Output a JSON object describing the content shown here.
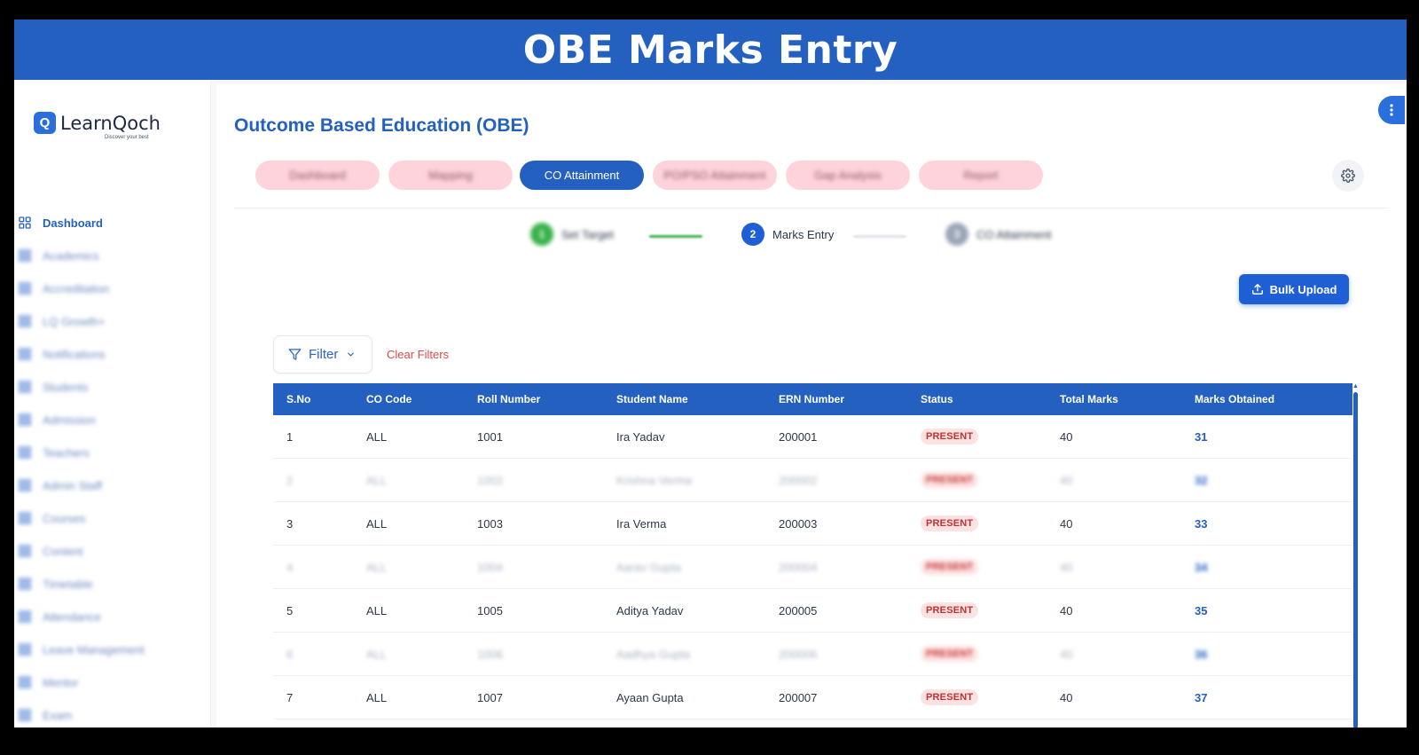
{
  "banner": {
    "title": "OBE Marks Entry"
  },
  "brand": {
    "name": "LearnQoch",
    "tagline": "Discover your best",
    "mark": "Q"
  },
  "sidebar": {
    "items": [
      {
        "label": "Dashboard",
        "icon": "dashboard-icon",
        "active": true
      },
      {
        "label": "Academics",
        "icon": "academics-icon"
      },
      {
        "label": "Accreditation",
        "icon": "accreditation-icon"
      },
      {
        "label": "LQ Growth+",
        "icon": "growth-icon"
      },
      {
        "label": "Notifications",
        "icon": "bell-icon"
      },
      {
        "label": "Students",
        "icon": "students-icon"
      },
      {
        "label": "Admission",
        "icon": "admission-icon"
      },
      {
        "label": "Teachers",
        "icon": "teachers-icon"
      },
      {
        "label": "Admin Staff",
        "icon": "staff-icon"
      },
      {
        "label": "Courses",
        "icon": "courses-icon"
      },
      {
        "label": "Content",
        "icon": "content-icon"
      },
      {
        "label": "Timetable",
        "icon": "timetable-icon"
      },
      {
        "label": "Attendance",
        "icon": "attendance-icon"
      },
      {
        "label": "Leave Management",
        "icon": "leave-icon"
      },
      {
        "label": "Mentor",
        "icon": "mentor-icon"
      },
      {
        "label": "Exam",
        "icon": "exam-icon"
      }
    ]
  },
  "page": {
    "title": "Outcome Based Education (OBE)"
  },
  "tabs": [
    {
      "label": "Dashboard",
      "active": false
    },
    {
      "label": "Mapping",
      "active": false
    },
    {
      "label": "CO Attainment",
      "active": true
    },
    {
      "label": "PO/PSO Attainment",
      "active": false
    },
    {
      "label": "Gap Analysis",
      "active": false
    },
    {
      "label": "Report",
      "active": false
    }
  ],
  "stepper": [
    {
      "num": "1",
      "label": "Set Target",
      "state": "done"
    },
    {
      "num": "2",
      "label": "Marks Entry",
      "state": "current"
    },
    {
      "num": "3",
      "label": "CO Attainment",
      "state": "pending"
    }
  ],
  "actions": {
    "bulk_upload": "Bulk Upload",
    "filter": "Filter",
    "clear_filters": "Clear Filters"
  },
  "table": {
    "headers": [
      "S.No",
      "CO Code",
      "Roll Number",
      "Student Name",
      "ERN Number",
      "Status",
      "Total Marks",
      "Marks Obtained"
    ],
    "rows": [
      {
        "sno": "1",
        "co": "ALL",
        "roll": "1001",
        "name": "Ira Yadav",
        "ern": "200001",
        "status": "PRESENT",
        "total": "40",
        "obtained": "31",
        "blurred": false
      },
      {
        "sno": "2",
        "co": "ALL",
        "roll": "1002",
        "name": "Krishna Verma",
        "ern": "200002",
        "status": "PRESENT",
        "total": "40",
        "obtained": "32",
        "blurred": true
      },
      {
        "sno": "3",
        "co": "ALL",
        "roll": "1003",
        "name": "Ira Verma",
        "ern": "200003",
        "status": "PRESENT",
        "total": "40",
        "obtained": "33",
        "blurred": false
      },
      {
        "sno": "4",
        "co": "ALL",
        "roll": "1004",
        "name": "Aarav Gupta",
        "ern": "200004",
        "status": "PRESENT",
        "total": "40",
        "obtained": "34",
        "blurred": true
      },
      {
        "sno": "5",
        "co": "ALL",
        "roll": "1005",
        "name": "Aditya Yadav",
        "ern": "200005",
        "status": "PRESENT",
        "total": "40",
        "obtained": "35",
        "blurred": false
      },
      {
        "sno": "6",
        "co": "ALL",
        "roll": "1006",
        "name": "Aadhya Gupta",
        "ern": "200006",
        "status": "PRESENT",
        "total": "40",
        "obtained": "36",
        "blurred": true
      },
      {
        "sno": "7",
        "co": "ALL",
        "roll": "1007",
        "name": "Ayaan Gupta",
        "ern": "200007",
        "status": "PRESENT",
        "total": "40",
        "obtained": "37",
        "blurred": false
      }
    ]
  },
  "colors": {
    "primary": "#2460c0",
    "tab_inactive": "#ffd3dc",
    "present_bg": "#fde2e2",
    "present_text": "#c53030",
    "done": "#38b24a",
    "clear": "#e04848"
  }
}
